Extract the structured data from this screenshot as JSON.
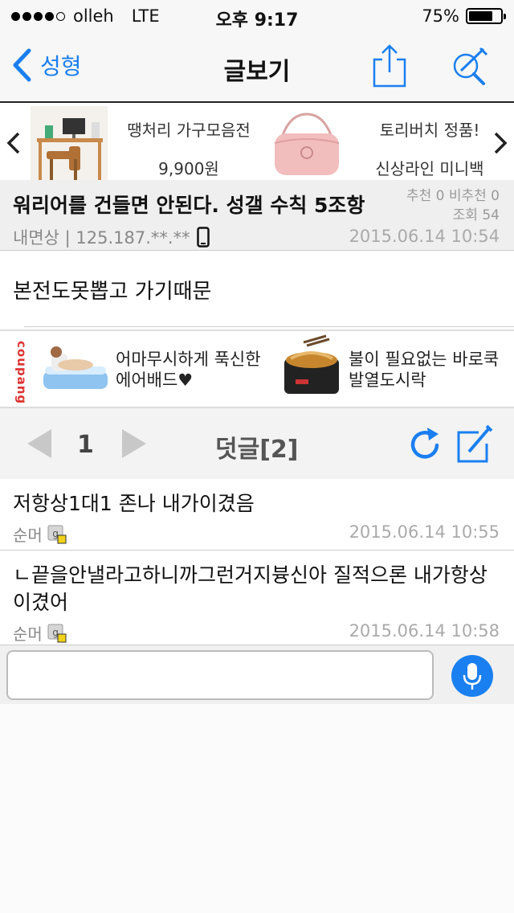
{
  "status_bar": {
    "carrier": "olleh",
    "network": "LTE",
    "time": "오후 9:17",
    "battery": "75%",
    "battery_level": 0.75
  },
  "nav": {
    "back_label": "성형",
    "title": "글보기"
  },
  "ad_top": {
    "item1_name": "땡처리 가구모음전",
    "item1_price": "9,900원",
    "item2_name": "토리버치 정품!",
    "item2_desc": "신상라인 미니백"
  },
  "post": {
    "title": "워리어를 건들면 안된다. 성갤 수칙 5조항",
    "recommend": "추천 0 비추천 0",
    "views": "조회 54",
    "author_ip": "내면상 | 125.187.**.**",
    "date": "2015.06.14 10:54",
    "content": "본전도못뽑고 가기때문"
  },
  "ad_mid": {
    "brand": "coupang",
    "item1_line1": "어마무시하게 푹신한",
    "item1_line2": "에어배드♥",
    "item2_line1": "불이 필요없는 바로쿡",
    "item2_line2": "발열도시락"
  },
  "comment_bar": {
    "page": "1",
    "title": "덧글[2]"
  },
  "comments": [
    {
      "text": "저항상1대1  존나 내가이겼음",
      "author": "순머",
      "date": "2015.06.14 10:55"
    },
    {
      "text": "ㄴ끝을안낼라고하니까그런거지븅신아 질적으론 내가항상이겼어",
      "author": "순머",
      "date": "2015.06.14 10:58"
    }
  ],
  "input": {
    "placeholder": ""
  },
  "colors": {
    "accent": "#1a7ff0"
  }
}
